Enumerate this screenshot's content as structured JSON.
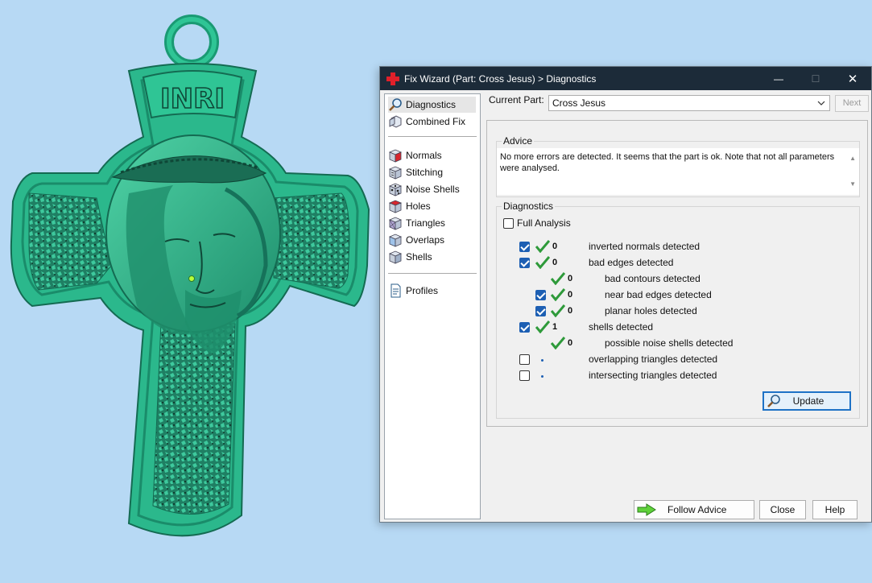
{
  "viewport": {
    "model_name": "Cross Jesus",
    "plaque_text": "INRI",
    "model_color": "#2fb88f"
  },
  "window": {
    "title": "Fix Wizard (Part: Cross Jesus) > Diagnostics",
    "controls": {
      "minimize": "—",
      "maximize": "☐",
      "close": "✕"
    }
  },
  "nav": {
    "top_items": [
      {
        "label": "Diagnostics",
        "icon": "magnifier-icon",
        "selected": true
      },
      {
        "label": "Combined Fix",
        "icon": "combined-fix-icon"
      }
    ],
    "fix_items": [
      {
        "label": "Normals",
        "icon": "normals-cube-icon"
      },
      {
        "label": "Stitching",
        "icon": "stitching-cube-icon"
      },
      {
        "label": "Noise Shells",
        "icon": "noise-shells-icon"
      },
      {
        "label": "Holes",
        "icon": "holes-cube-icon"
      },
      {
        "label": "Triangles",
        "icon": "triangles-cube-icon"
      },
      {
        "label": "Overlaps",
        "icon": "overlaps-cube-icon"
      },
      {
        "label": "Shells",
        "icon": "shells-cube-icon"
      }
    ],
    "bottom_items": [
      {
        "label": "Profiles",
        "icon": "profiles-document-icon"
      }
    ]
  },
  "current_part": {
    "label": "Current Part:",
    "value": "Cross Jesus",
    "next_label": "Next"
  },
  "advice": {
    "label": "Advice",
    "text": "No more errors are detected. It seems that the part is ok. Note that not all parameters were analysed."
  },
  "diagnostics": {
    "label": "Diagnostics",
    "full_analysis_label": "Full Analysis",
    "full_analysis_checked": false,
    "rows": [
      {
        "checkbox": true,
        "checked": true,
        "status": "ok",
        "count": "0",
        "text": "inverted normals detected",
        "indent": 0
      },
      {
        "checkbox": true,
        "checked": true,
        "status": "ok",
        "count": "0",
        "text": "bad edges detected",
        "indent": 0
      },
      {
        "checkbox": false,
        "checked": false,
        "status": "ok",
        "count": "0",
        "text": "bad contours detected",
        "indent": 1
      },
      {
        "checkbox": true,
        "checked": true,
        "status": "ok",
        "count": "0",
        "text": "near bad edges detected",
        "indent": 1
      },
      {
        "checkbox": true,
        "checked": true,
        "status": "ok",
        "count": "0",
        "text": "planar holes detected",
        "indent": 1
      },
      {
        "checkbox": true,
        "checked": true,
        "status": "ok",
        "count": "1",
        "text": "shells detected",
        "indent": 0
      },
      {
        "checkbox": false,
        "checked": false,
        "status": "ok",
        "count": "0",
        "text": "possible noise shells detected",
        "indent": 1
      },
      {
        "checkbox": true,
        "checked": false,
        "status": "unknown",
        "count": "",
        "text": "overlapping triangles detected",
        "indent": 0
      },
      {
        "checkbox": true,
        "checked": false,
        "status": "unknown",
        "count": "",
        "text": "intersecting triangles detected",
        "indent": 0
      }
    ],
    "update_label": "Update"
  },
  "footer": {
    "follow_advice_label": "Follow Advice",
    "close_label": "Close",
    "help_label": "Help"
  },
  "colors": {
    "titlebar": "#1c2b39",
    "accent": "#1d5fb3",
    "ok_check": "#2e9a3a",
    "background": "#b7d9f4"
  }
}
